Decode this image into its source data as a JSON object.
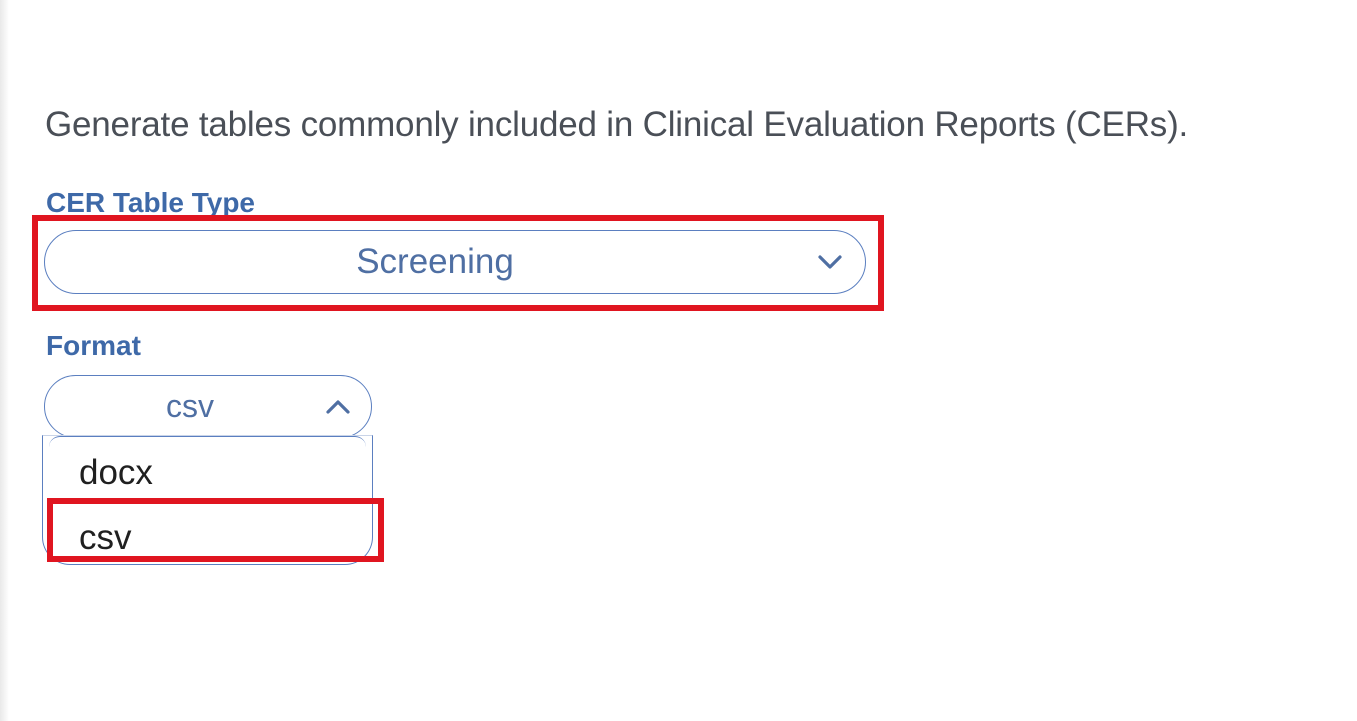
{
  "description": "Generate tables commonly included in Clinical Evaluation Reports (CERs).",
  "cer_table_type": {
    "label": "CER Table Type",
    "selected": "Screening",
    "icon": "chevron-down-icon"
  },
  "format": {
    "label": "Format",
    "selected": "csv",
    "icon": "chevron-up-icon",
    "options": [
      "docx",
      "csv"
    ]
  },
  "colors": {
    "label": "#3e69a8",
    "select_border": "#5b7fc0",
    "select_text": "#4f6fa3",
    "highlight": "#e01520"
  }
}
